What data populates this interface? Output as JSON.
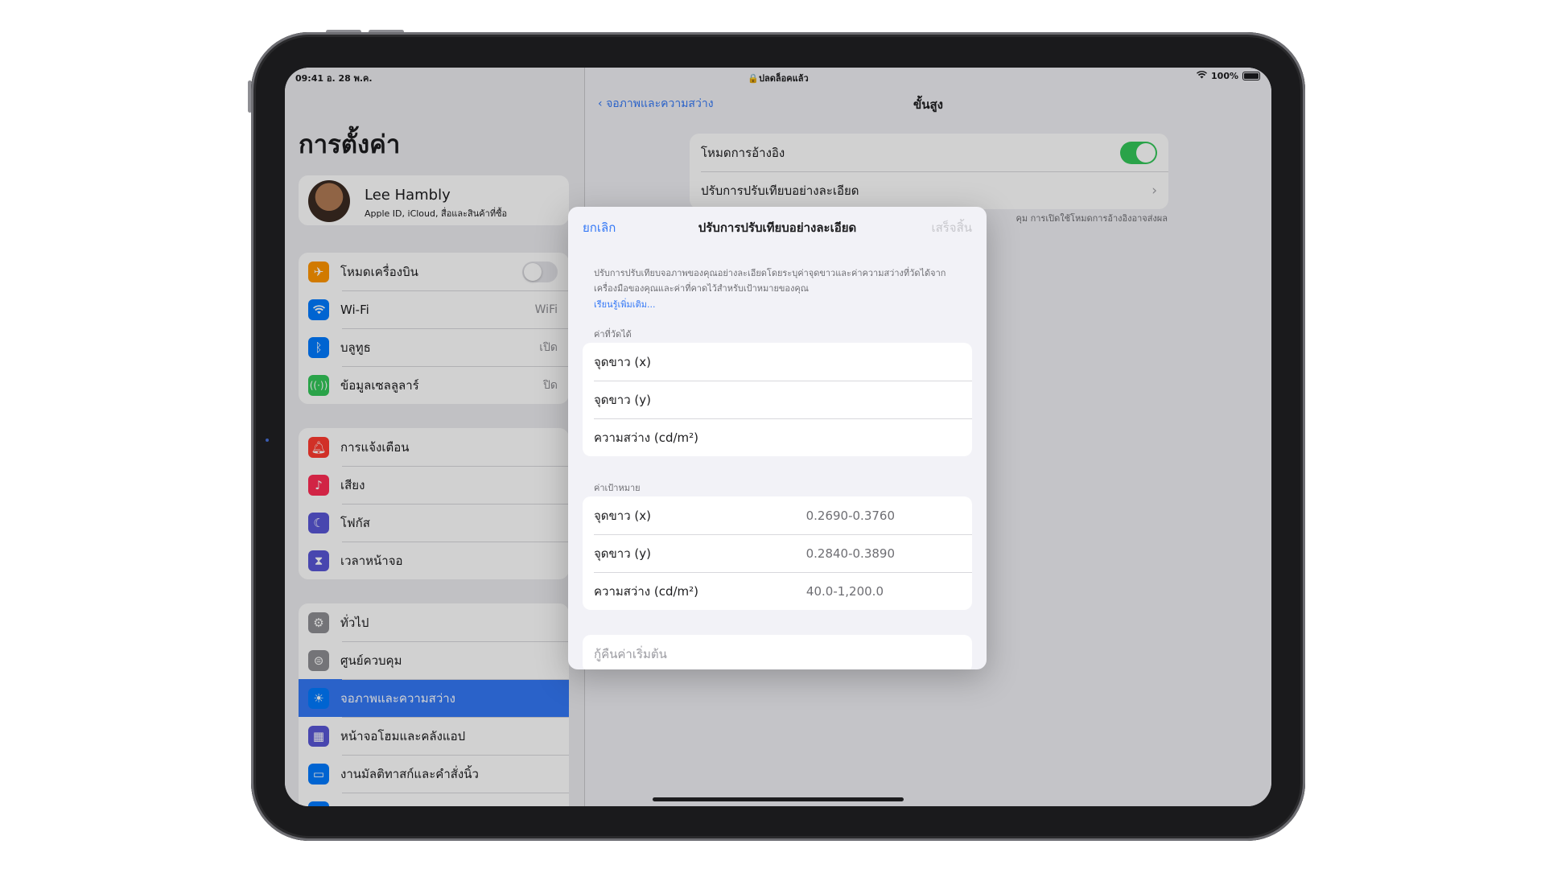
{
  "status": {
    "time": "09:41  อ. 28 พ.ค.",
    "lock_text": "ปลดล็อคแล้ว",
    "battery": "100%"
  },
  "sidebar": {
    "title": "การตั้งค่า",
    "profile": {
      "name": "Lee Hambly",
      "subtitle": "Apple ID, iCloud, สื่อและสินค้าที่ซื้อ"
    },
    "group1": [
      {
        "label": "โหมดเครื่องบิน",
        "value": "",
        "color": "#ff9500",
        "icon": "airplane-icon"
      },
      {
        "label": "Wi-Fi",
        "value": "WiFi",
        "color": "#007aff",
        "icon": "wifi-icon"
      },
      {
        "label": "บลูทูธ",
        "value": "เปิด",
        "color": "#007aff",
        "icon": "bluetooth-icon"
      },
      {
        "label": "ข้อมูลเซลลูลาร์",
        "value": "ปิด",
        "color": "#34c759",
        "icon": "cellular-icon"
      }
    ],
    "group2": [
      {
        "label": "การแจ้งเตือน",
        "color": "#ff3b30",
        "icon": "bell-icon"
      },
      {
        "label": "เสียง",
        "color": "#ff2d55",
        "icon": "speaker-icon"
      },
      {
        "label": "โฟกัส",
        "color": "#5856d6",
        "icon": "moon-icon"
      },
      {
        "label": "เวลาหน้าจอ",
        "color": "#5856d6",
        "icon": "hourglass-icon"
      }
    ],
    "group3": [
      {
        "label": "ทั่วไป",
        "color": "#8e8e93",
        "icon": "gear-icon"
      },
      {
        "label": "ศูนย์ควบคุม",
        "color": "#8e8e93",
        "icon": "toggles-icon"
      },
      {
        "label": "จอภาพและความสว่าง",
        "color": "#007aff",
        "icon": "sun-icon"
      },
      {
        "label": "หน้าจอโฮมและคลังแอป",
        "color": "#5856d6",
        "icon": "grid-icon"
      },
      {
        "label": "งานมัลติทาสก์และคำสั่งนิ้ว",
        "color": "#007aff",
        "icon": "multitask-icon"
      }
    ]
  },
  "detail": {
    "back_label": "จอภาพและความสว่าง",
    "title": "ขั้นสูง",
    "reference_mode": "โหมดการอ้างอิง",
    "fine_tune": "ปรับการปรับเทียบอย่างละเอียด",
    "footer": "คุม การเปิดใช้โหมดการอ้างอิงอาจส่งผล"
  },
  "modal": {
    "cancel": "ยกเลิก",
    "title": "ปรับการปรับเทียบอย่างละเอียด",
    "done": "เสร็จสิ้น",
    "description": "ปรับการปรับเทียบจอภาพของคุณอย่างละเอียดโดยระบุค่าจุดขาวและค่าความสว่างที่วัดได้จากเครื่องมือของคุณและค่าที่คาดไว้สำหรับเป้าหมายของคุณ",
    "learn_more": "เรียนรู้เพิ่มเติม...",
    "measured_header": "ค่าที่วัดได้",
    "measured": [
      {
        "label": "จุดขาว (x)"
      },
      {
        "label": "จุดขาว (y)"
      },
      {
        "label": "ความสว่าง (cd/m²)"
      }
    ],
    "target_header": "ค่าเป้าหมาย",
    "target": [
      {
        "label": "จุดขาว (x)",
        "value": "0.2690-0.3760"
      },
      {
        "label": "จุดขาว (y)",
        "value": "0.2840-0.3890"
      },
      {
        "label": "ความสว่าง (cd/m²)",
        "value": "40.0-1,200.0"
      }
    ],
    "reset": "กู้คืนค่าเริ่มต้น"
  }
}
